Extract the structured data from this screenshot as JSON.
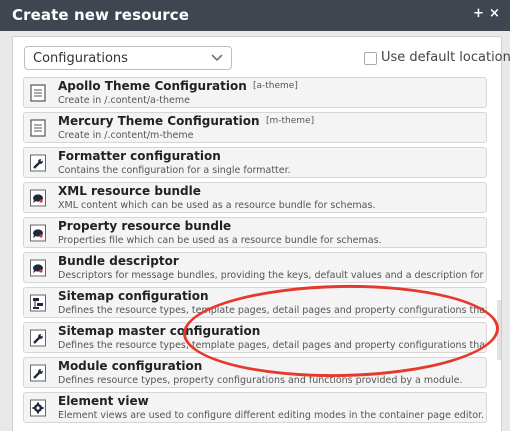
{
  "dialog": {
    "title": "Create new resource",
    "buttons": {
      "maximize": "+",
      "close": "×"
    }
  },
  "filter": {
    "selected": "Configurations",
    "checkbox_label": "Use default location",
    "checkbox_checked": false
  },
  "items": [
    {
      "title": "Apollo Theme Configuration",
      "subtitle": "[a-theme]",
      "desc": "Create in /.content/a-theme",
      "icon": "document-icon"
    },
    {
      "title": "Mercury Theme Configuration",
      "subtitle": "[m-theme]",
      "desc": "Create in /.content/m-theme",
      "icon": "document-icon"
    },
    {
      "title": "Formatter configuration",
      "subtitle": "",
      "desc": "Contains the configuration for a single formatter.",
      "icon": "wrench-icon"
    },
    {
      "title": "XML resource bundle",
      "subtitle": "",
      "desc": "XML content which can be used as a resource bundle for schemas.",
      "icon": "bubble-icon"
    },
    {
      "title": "Property resource bundle",
      "subtitle": "",
      "desc": "Properties file which can be used as a resource bundle for schemas.",
      "icon": "bubble-icon"
    },
    {
      "title": "Bundle descriptor",
      "subtitle": "",
      "desc": "Descriptors for message bundles, providing the keys, default values and a description for ea",
      "icon": "bubble-icon"
    },
    {
      "title": "Sitemap configuration",
      "subtitle": "",
      "desc": "Defines the resource types, template pages, detail pages and property configurations that ca",
      "icon": "sitemap-icon"
    },
    {
      "title": "Sitemap master configuration",
      "subtitle": "",
      "desc": "Defines the resource types, template pages, detail pages and property configurations that ca",
      "icon": "wrench-icon"
    },
    {
      "title": "Module configuration",
      "subtitle": "",
      "desc": "Defines resource types, property configurations and functions provided by a module.",
      "icon": "wrench-icon"
    },
    {
      "title": "Element view",
      "subtitle": "",
      "desc": "Element views are used to configure different editing modes in the container page editor.",
      "icon": "gear-icon"
    }
  ],
  "colors": {
    "titlebar": "#3f4650",
    "highlight_oval": "#e5392b"
  }
}
